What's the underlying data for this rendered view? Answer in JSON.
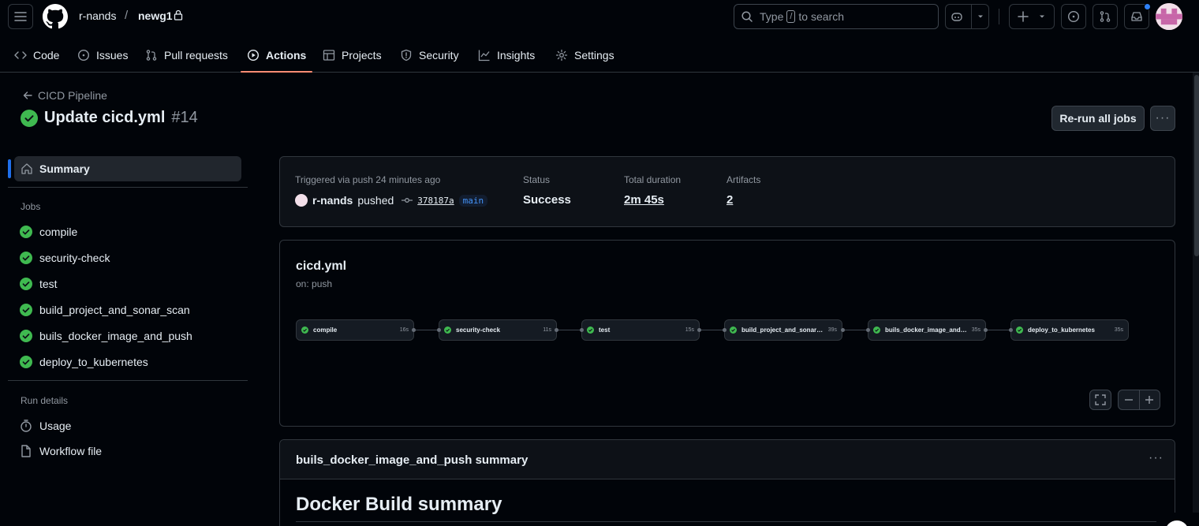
{
  "header": {
    "owner": "r-nands",
    "separator": "/",
    "repo": "newg1",
    "search_prefix": "Type",
    "search_key": "/",
    "search_suffix": "to search"
  },
  "tabs": [
    {
      "label": "Code",
      "icon": "code-icon"
    },
    {
      "label": "Issues",
      "icon": "issue-icon"
    },
    {
      "label": "Pull requests",
      "icon": "pull-request-icon"
    },
    {
      "label": "Actions",
      "icon": "play-icon",
      "active": true
    },
    {
      "label": "Projects",
      "icon": "table-icon"
    },
    {
      "label": "Security",
      "icon": "shield-icon"
    },
    {
      "label": "Insights",
      "icon": "graph-icon"
    },
    {
      "label": "Settings",
      "icon": "gear-icon"
    }
  ],
  "run": {
    "back_label": "CICD Pipeline",
    "title": "Update cicd.yml",
    "number": "#14",
    "rerun_label": "Re-run all jobs",
    "more_label": "···"
  },
  "sidebar": {
    "summary_label": "Summary",
    "jobs_heading": "Jobs",
    "jobs": [
      "compile",
      "security-check",
      "test",
      "build_project_and_sonar_scan",
      "buils_docker_image_and_push",
      "deploy_to_kubernetes"
    ],
    "details_heading": "Run details",
    "usage_label": "Usage",
    "workflow_file_label": "Workflow file"
  },
  "summary": {
    "trigger_label": "Triggered via push 24 minutes ago",
    "actor": "r-nands",
    "action": "pushed",
    "commit": "378187a",
    "branch": "main",
    "status_label": "Status",
    "status_value": "Success",
    "duration_label": "Total duration",
    "duration_value": "2m 45s",
    "artifacts_label": "Artifacts",
    "artifacts_value": "2"
  },
  "workflow": {
    "name": "cicd.yml",
    "trigger": "on: push",
    "jobs": [
      {
        "name": "compile",
        "duration": "16s"
      },
      {
        "name": "security-check",
        "duration": "11s"
      },
      {
        "name": "test",
        "duration": "15s"
      },
      {
        "name": "build_project_and_sonar_scan",
        "duration": "39s"
      },
      {
        "name": "buils_docker_image_and_pu...",
        "duration": "35s"
      },
      {
        "name": "deploy_to_kubernetes",
        "duration": "35s"
      }
    ]
  },
  "docker_summary": {
    "card_title": "buils_docker_image_and_push summary",
    "heading": "Docker Build summary",
    "more_label": "···"
  },
  "colors": {
    "success": "#3fb950",
    "accent": "#1f6feb",
    "active_tab_underline": "#fd8c73"
  }
}
